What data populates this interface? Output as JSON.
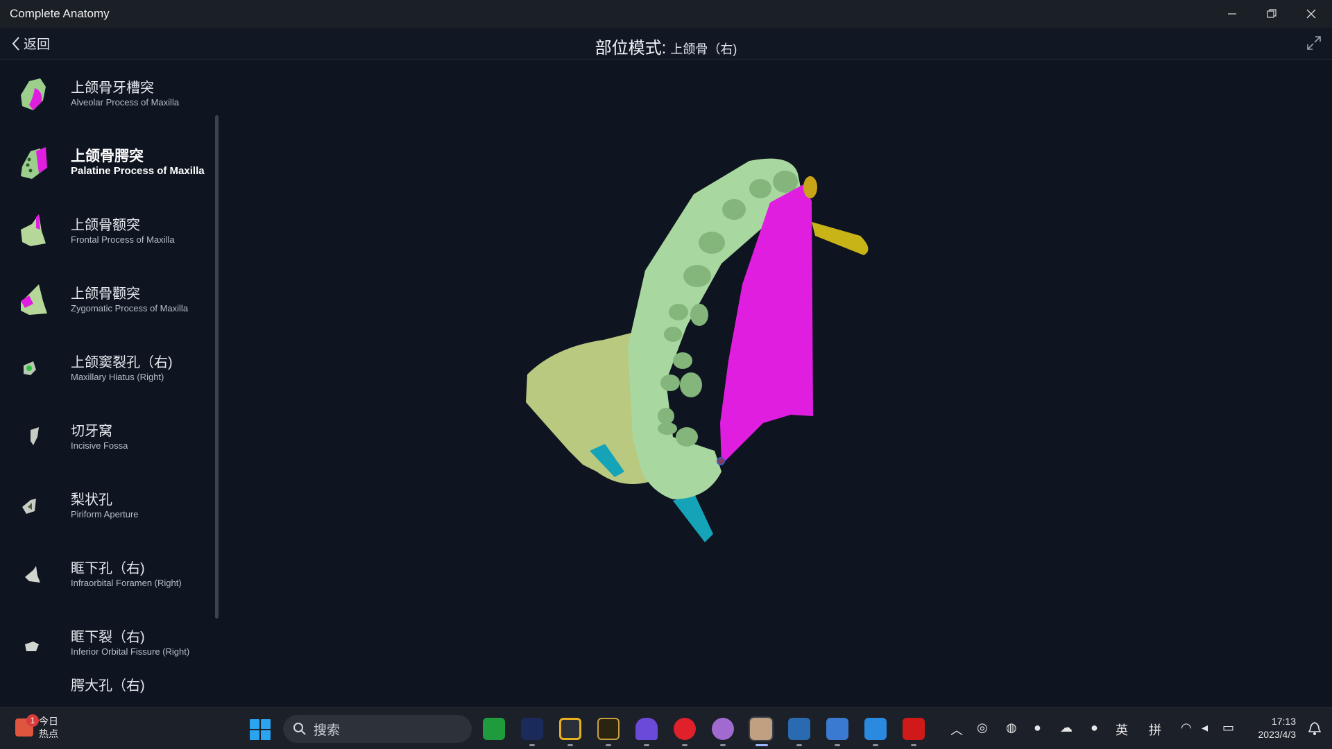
{
  "window": {
    "title": "Complete Anatomy"
  },
  "header": {
    "back_label": "返回",
    "mode_label": "部位模式:",
    "mode_value": "上颌骨（右)"
  },
  "sidebar": {
    "items": [
      {
        "zh": "上颌骨牙槽突",
        "en": "Alveolar Process of Maxilla"
      },
      {
        "zh": "上颌骨腭突",
        "en": "Palatine Process of Maxilla"
      },
      {
        "zh": "上颌骨额突",
        "en": "Frontal Process of Maxilla"
      },
      {
        "zh": "上颌骨颧突",
        "en": "Zygomatic Process of Maxilla"
      },
      {
        "zh": "上颌窦裂孔（右)",
        "en": "Maxillary Hiatus (Right)"
      },
      {
        "zh": "切牙窝",
        "en": "Incisive Fossa"
      },
      {
        "zh": "梨状孔",
        "en": "Piriform Aperture"
      },
      {
        "zh": "眶下孔（右)",
        "en": "Infraorbital Foramen (Right)"
      },
      {
        "zh": "眶下裂（右)",
        "en": "Inferior Orbital Fissure (Right)"
      },
      {
        "zh": "腭大孔（右)",
        "en": ""
      }
    ]
  },
  "colors": {
    "highlight": "#e01ee0",
    "bone": "#a8d8a0",
    "bone_dark": "#b9c97f",
    "accent_yellow": "#c9b418",
    "accent_cyan": "#15a3b8"
  },
  "taskbar": {
    "widget_badge": "1",
    "widget_line1": "今日",
    "widget_line2": "热点",
    "search_label": "搜索",
    "ime_lang": "英",
    "ime_mode": "拼",
    "time": "17:13",
    "date": "2023/4/3"
  }
}
